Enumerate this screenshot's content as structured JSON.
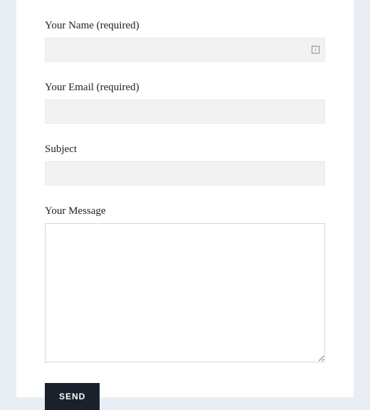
{
  "form": {
    "name": {
      "label": "Your Name (required)",
      "value": ""
    },
    "email": {
      "label": "Your Email (required)",
      "value": ""
    },
    "subject": {
      "label": "Subject",
      "value": ""
    },
    "message": {
      "label": "Your Message",
      "value": ""
    },
    "submit_label": "SEND"
  }
}
